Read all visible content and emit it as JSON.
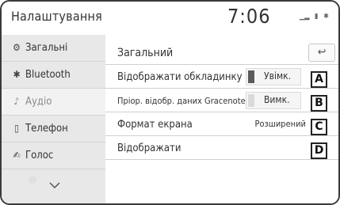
{
  "header": {
    "title": "Налаштування",
    "time": "7:06",
    "status_icons": [
      "signal-icon",
      "battery-icon",
      "bluetooth-icon"
    ]
  },
  "sidebar": {
    "items": [
      {
        "label": "Загальні",
        "icon": "gear-icon",
        "glyph": "⚙"
      },
      {
        "label": "Bluetooth",
        "icon": "bluetooth-icon",
        "glyph": "✱"
      },
      {
        "label": "Аудіо",
        "icon": "music-note-icon",
        "glyph": "♪"
      },
      {
        "label": "Телефон",
        "icon": "phone-icon",
        "glyph": "▯"
      },
      {
        "label": "Голос",
        "icon": "voice-icon",
        "glyph": "✍"
      }
    ],
    "active_index": 2,
    "more_icon": "chevron-down-icon"
  },
  "content": {
    "section_title": "Загальний",
    "back_icon": "back-arrow-icon",
    "rows": [
      {
        "label": "Відображати обкладинку",
        "value": "Увімк.",
        "callout": "A"
      },
      {
        "label": "Пріор. відобр. даних Gracenote",
        "value": "Вимк.",
        "callout": "B"
      },
      {
        "label": "Формат екрана",
        "value": "Розширений",
        "callout": "C"
      },
      {
        "label": "Відображати",
        "value": "",
        "callout": "D"
      }
    ]
  },
  "colors": {
    "toggle_on": "#5a5a5a",
    "toggle_off": "#dadada",
    "sidebar_bg": "#e8e8e8"
  }
}
